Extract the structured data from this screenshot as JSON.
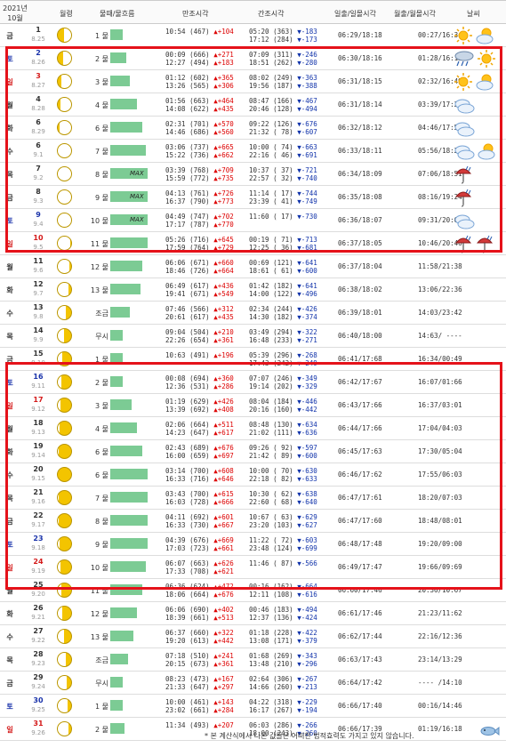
{
  "header": {
    "date_line1": "2021년",
    "date_line2": "10월",
    "phase": "월령",
    "tide": "물때/물흐름",
    "high": "만조시각",
    "low": "간조시각",
    "sun": "일출/일몰시각",
    "moon": "월출/월몰시각",
    "weather": "날씨"
  },
  "rows": [
    {
      "dow": "금",
      "day": "1",
      "lunar": "8.25",
      "mul": "1 물",
      "bar": 14,
      "hi1": "10:54 (467)",
      "hi1d": "▲+104",
      "hi2": "",
      "hi2d": "",
      "lo1": "05:20 (363)",
      "lo1d": "▼-183",
      "lo2": "17:12 (284)",
      "lo2d": "▼-173",
      "sun": "06:29/18:18",
      "moon": "00:27/16:34",
      "wx": [
        "sun",
        "suncloud"
      ],
      "illum": 0.5
    },
    {
      "dow": "토",
      "day": "2",
      "lunar": "8.26",
      "mul": "2 물",
      "bar": 18,
      "hi1": "00:09 (666)",
      "hi1d": "▲+271",
      "hi2": "12:27 (494)",
      "hi2d": "▲+183",
      "lo1": "07:09 (311)",
      "lo1d": "▼-246",
      "lo2": "18:51 (262)",
      "lo2d": "▼-280",
      "sun": "06:30/18:16",
      "moon": "01:28/16:13",
      "wx": [
        "rain",
        "sun"
      ],
      "illum": 0.45
    },
    {
      "dow": "일",
      "day": "3",
      "lunar": "8.27",
      "mul": "3 물",
      "bar": 22,
      "hi1": "01:12 (602)",
      "hi1d": "▲+365",
      "hi2": "13:26 (565)",
      "hi2d": "▲+306",
      "lo1": "08:02 (249)",
      "lo1d": "▼-363",
      "lo2": "19:56 (187)",
      "lo2d": "▼-388",
      "sun": "06:31/18:15",
      "moon": "02:32/16:49",
      "wx": [
        "sun",
        "suncloud"
      ],
      "illum": 0.38
    },
    {
      "dow": "월",
      "day": "4",
      "lunar": "8.28",
      "mul": "4 물",
      "bar": 30,
      "hi1": "01:56 (663)",
      "hi1d": "▲+464",
      "hi2": "14:08 (622)",
      "hi2d": "▲+435",
      "lo1": "08:47 (166)",
      "lo1d": "▼-467",
      "lo2": "20:46 (128)",
      "lo2d": "▼-494",
      "sun": "06:31/18:14",
      "moon": "03:39/17:21",
      "wx": [
        "cloud"
      ],
      "illum": 0.3
    },
    {
      "dow": "화",
      "day": "6",
      "lunar": "8.29",
      "mul": "6 물",
      "bar": 36,
      "hi1": "02:31 (701)",
      "hi1d": "▲+570",
      "hi2": "14:46 (686)",
      "hi2d": "▲+560",
      "lo1": "09:22 (126)",
      "lo1d": "▼-676",
      "lo2": "21:32 ( 78)",
      "lo2d": "▼-607",
      "sun": "06:32/18:12",
      "moon": "04:46/17:51",
      "wx": [
        "cloud"
      ],
      "illum": 0.22
    },
    {
      "dow": "수",
      "day": "6",
      "lunar": "9.1",
      "mul": "7 물",
      "bar": 40,
      "hi1": "03:06 (737)",
      "hi1d": "▲+665",
      "hi2": "15:22 (736)",
      "hi2d": "▲+662",
      "lo1": "10:00 ( 74)",
      "lo1d": "▼-663",
      "lo2": "22:16 ( 46)",
      "lo2d": "▼-691",
      "sun": "06:33/18:11",
      "moon": "05:56/18:20",
      "wx": [
        "cloud",
        "suncloud"
      ],
      "illum": 0.14
    },
    {
      "dow": "목",
      "day": "7",
      "lunar": "9.2",
      "mul": "8 물",
      "bar": 42,
      "max": "MAX",
      "hi1": "03:39 (768)",
      "hi1d": "▲+709",
      "hi2": "15:59 (772)",
      "hi2d": "▲+735",
      "lo1": "10:37 ( 37)",
      "lo1d": "▼-721",
      "lo2": "22:57 ( 32)",
      "lo2d": "▼-740",
      "sun": "06:34/18:09",
      "moon": "07:06/18:51",
      "wx": [
        "umbrella"
      ],
      "illum": 0.08
    },
    {
      "dow": "금",
      "day": "8",
      "lunar": "9.3",
      "mul": "9 물",
      "bar": 42,
      "max": "MAX",
      "hi1": "04:13 (761)",
      "hi1d": "▲+726",
      "hi2": "16:37 (790)",
      "hi2d": "▲+773",
      "lo1": "11:14 ( 17)",
      "lo1d": "▼-744",
      "lo2": "23:39 ( 41)",
      "lo2d": "▼-749",
      "sun": "06:35/18:08",
      "moon": "08:16/19:24",
      "wx": [
        "umbrella"
      ],
      "illum": 0.06
    },
    {
      "dow": "토",
      "day": "9",
      "lunar": "9.4",
      "mul": "10 물",
      "bar": 42,
      "max": "MAX",
      "hi1": "04:49 (747)",
      "hi1d": "▲+702",
      "hi2": "17:17 (787)",
      "hi2d": "▲+770",
      "lo1": "11:60 ( 17)",
      "lo1d": "▼-730",
      "lo2": "",
      "lo2d": "",
      "sun": "06:36/18:07",
      "moon": "09:31/20:02",
      "wx": [
        "cloud"
      ],
      "illum": 0.1
    },
    {
      "dow": "일",
      "day": "10",
      "lunar": "9.5",
      "mul": "11 물",
      "bar": 42,
      "hi1": "05:26 (716)",
      "hi1d": "▲+645",
      "hi2": "17:59 (764)",
      "hi2d": "▲+729",
      "lo1": "00:19 ( 71)",
      "lo1d": "▼-713",
      "lo2": "12:25 ( 36)",
      "lo2d": "▼-681",
      "sun": "06:37/18:05",
      "moon": "10:46/20:46",
      "wx": [
        "umbrella",
        "umbrella"
      ],
      "illum": 0.16
    },
    {
      "dow": "월",
      "day": "11",
      "lunar": "9.6",
      "mul": "12 물",
      "bar": 36,
      "hi1": "06:06 (671)",
      "hi1d": "▲+660",
      "hi2": "18:46 (726)",
      "hi2d": "▲+664",
      "lo1": "00:69 (121)",
      "lo1d": "▼-641",
      "lo2": "18:61 ( 61)",
      "lo2d": "▼-600",
      "sun": "06:37/18:04",
      "moon": "11:58/21:38",
      "wx": [],
      "illum": 0.22
    },
    {
      "dow": "화",
      "day": "12",
      "lunar": "9.7",
      "mul": "13 물",
      "bar": 34,
      "hi1": "06:49 (617)",
      "hi1d": "▲+436",
      "hi2": "19:41 (671)",
      "hi2d": "▲+549",
      "lo1": "01:42 (182)",
      "lo1d": "▼-641",
      "lo2": "14:00 (122)",
      "lo2d": "▼-496",
      "sun": "06:38/18:02",
      "moon": "13:06/22:36",
      "wx": [],
      "illum": 0.3
    },
    {
      "dow": "수",
      "day": "13",
      "lunar": "9.8",
      "mul": "조금",
      "bar": 22,
      "hi1": "07:46 (566)",
      "hi1d": "▲+312",
      "hi2": "20:61 (617)",
      "hi2d": "▲+435",
      "lo1": "02:34 (244)",
      "lo1d": "▼-426",
      "lo2": "14:30 (182)",
      "lo2d": "▼-374",
      "sun": "06:39/18:01",
      "moon": "14:03/23:42",
      "wx": [],
      "illum": 0.5
    },
    {
      "dow": "목",
      "day": "14",
      "lunar": "9.9",
      "mul": "무시",
      "bar": 14,
      "hi1": "09:04 (504)",
      "hi1d": "▲+210",
      "hi2": "22:26 (654)",
      "hi2d": "▲+361",
      "lo1": "03:49 (294)",
      "lo1d": "▼-322",
      "lo2": "16:48 (233)",
      "lo2d": "▼-271",
      "sun": "06:40/18:00",
      "moon": "14:63/ ----",
      "wx": [],
      "illum": 0.6
    },
    {
      "dow": "금",
      "day": "15",
      "lunar": "9.10",
      "mul": "1 물",
      "bar": 14,
      "hi1": "10:63 (491)",
      "hi1d": "▲+196",
      "hi2": "",
      "hi2d": "",
      "lo1": "05:39 (296)",
      "lo1d": "▼-268",
      "lo2": "17:43 (242)",
      "lo2d": "▼-249",
      "sun": "06:41/17:68",
      "moon": "16:34/00:49",
      "wx": [],
      "illum": 0.68
    },
    {
      "dow": "토",
      "day": "16",
      "lunar": "9.11",
      "mul": "2 물",
      "bar": 14,
      "hi1": "00:08 (694)",
      "hi1d": "▲+360",
      "hi2": "12:36 (531)",
      "hi2d": "▲+286",
      "lo1": "07:07 (246)",
      "lo1d": "▼-349",
      "lo2": "19:14 (202)",
      "lo2d": "▼-329",
      "sun": "06:42/17:67",
      "moon": "16:07/01:66",
      "wx": [],
      "illum": 0.76
    },
    {
      "dow": "일",
      "day": "17",
      "lunar": "9.12",
      "mul": "3 물",
      "bar": 24,
      "hi1": "01:19 (629)",
      "hi1d": "▲+426",
      "hi2": "13:39 (692)",
      "hi2d": "▲+408",
      "lo1": "08:04 (184)",
      "lo1d": "▼-446",
      "lo2": "20:16 (160)",
      "lo2d": "▼-442",
      "sun": "06:43/17:66",
      "moon": "16:37/03:01",
      "wx": [],
      "illum": 0.84
    },
    {
      "dow": "월",
      "day": "18",
      "lunar": "9.13",
      "mul": "4 물",
      "bar": 30,
      "hi1": "02:06 (664)",
      "hi1d": "▲+511",
      "hi2": "14:23 (647)",
      "hi2d": "▲+617",
      "lo1": "08:48 (130)",
      "lo1d": "▼-634",
      "lo2": "21:02 (111)",
      "lo2d": "▼-636",
      "sun": "06:44/17:66",
      "moon": "17:04/04:03",
      "wx": [],
      "illum": 0.9
    },
    {
      "dow": "화",
      "day": "19",
      "lunar": "9.14",
      "mul": "6 물",
      "bar": 36,
      "hi1": "02:43 (689)",
      "hi1d": "▲+676",
      "hi2": "16:00 (659)",
      "hi2d": "▲+697",
      "lo1": "09:26 ( 92)",
      "lo1d": "▼-597",
      "lo2": "21:42 ( 89)",
      "lo2d": "▼-600",
      "sun": "06:45/17:63",
      "moon": "17:30/05:04",
      "wx": [],
      "illum": 0.95
    },
    {
      "dow": "수",
      "day": "20",
      "lunar": "9.15",
      "mul": "6 물",
      "bar": 42,
      "hi1": "03:14 (700)",
      "hi1d": "▲+608",
      "hi2": "16:33 (716)",
      "hi2d": "▲+646",
      "lo1": "10:00 ( 70)",
      "lo1d": "▼-630",
      "lo2": "22:18 ( 82)",
      "lo2d": "▼-633",
      "sun": "06:46/17:62",
      "moon": "17:55/06:03",
      "wx": [],
      "illum": 1
    },
    {
      "dow": "목",
      "day": "21",
      "lunar": "9.16",
      "mul": "7 물",
      "bar": 42,
      "hi1": "03:43 (700)",
      "hi1d": "▲+615",
      "hi2": "16:03 (728)",
      "hi2d": "▲+666",
      "lo1": "10:30 ( 62)",
      "lo1d": "▼-638",
      "lo2": "22:60 ( 68)",
      "lo2d": "▼-640",
      "sun": "06:47/17:61",
      "moon": "18:20/07:03",
      "wx": [],
      "illum": 0.98
    },
    {
      "dow": "금",
      "day": "22",
      "lunar": "9.17",
      "mul": "8 물",
      "bar": 42,
      "hi1": "04:11 (692)",
      "hi1d": "▲+601",
      "hi2": "16:33 (730)",
      "hi2d": "▲+667",
      "lo1": "10:67 ( 63)",
      "lo1d": "▼-629",
      "lo2": "23:20 (103)",
      "lo2d": "▼-627",
      "sun": "06:47/17:60",
      "moon": "18:48/08:01",
      "wx": [],
      "illum": 0.94
    },
    {
      "dow": "토",
      "day": "23",
      "lunar": "9.18",
      "mul": "9 물",
      "bar": 42,
      "hi1": "04:39 (676)",
      "hi1d": "▲+669",
      "hi2": "17:03 (723)",
      "hi2d": "▲+661",
      "lo1": "11:22 ( 72)",
      "lo1d": "▼-603",
      "lo2": "23:48 (124)",
      "lo2d": "▼-699",
      "sun": "06:48/17:48",
      "moon": "19:20/09:00",
      "wx": [],
      "illum": 0.88
    },
    {
      "dow": "일",
      "day": "24",
      "lunar": "9.19",
      "mul": "10 물",
      "bar": 40,
      "hi1": "06:07 (663)",
      "hi1d": "▲+626",
      "hi2": "17:33 (708)",
      "hi2d": "▲+621",
      "lo1": "11:46 ( 87)",
      "lo1d": "▼-566",
      "lo2": "",
      "lo2d": "",
      "sun": "06:49/17:47",
      "moon": "19:66/09:69",
      "wx": [],
      "illum": 0.82
    },
    {
      "dow": "월",
      "day": "25",
      "lunar": "9.20",
      "mul": "11 물",
      "bar": 36,
      "hi1": "06:36 (624)",
      "hi1d": "▲+472",
      "hi2": "18:06 (664)",
      "hi2d": "▲+676",
      "lo1": "00:16 (162)",
      "lo1d": "▼-664",
      "lo2": "12:11 (108)",
      "lo2d": "▼-616",
      "sun": "06:60/17:46",
      "moon": "20:36/10:67",
      "wx": [],
      "illum": 0.76
    },
    {
      "dow": "화",
      "day": "26",
      "lunar": "9.21",
      "mul": "12 물",
      "bar": 30,
      "hi1": "06:06 (690)",
      "hi1d": "▲+402",
      "hi2": "18:39 (661)",
      "hi2d": "▲+513",
      "lo1": "00:46 (183)",
      "lo1d": "▼-494",
      "lo2": "12:37 (136)",
      "lo2d": "▼-424",
      "sun": "06:61/17:46",
      "moon": "21:23/11:62",
      "wx": [],
      "illum": 0.68
    },
    {
      "dow": "수",
      "day": "27",
      "lunar": "9.22",
      "mul": "13 물",
      "bar": 26,
      "hi1": "06:37 (660)",
      "hi1d": "▲+322",
      "hi2": "19:20 (613)",
      "hi2d": "▲+442",
      "lo1": "01:18 (228)",
      "lo1d": "▼-422",
      "lo2": "13:08 (171)",
      "lo2d": "▼-379",
      "sun": "06:62/17:44",
      "moon": "22:16/12:36",
      "wx": [],
      "illum": 0.6
    },
    {
      "dow": "목",
      "day": "28",
      "lunar": "9.23",
      "mul": "조금",
      "bar": 20,
      "hi1": "07:18 (510)",
      "hi1d": "▲+241",
      "hi2": "20:15 (673)",
      "hi2d": "▲+361",
      "lo1": "01:68 (269)",
      "lo1d": "▼-343",
      "lo2": "13:48 (210)",
      "lo2d": "▼-296",
      "sun": "06:63/17:43",
      "moon": "23:14/13:29",
      "wx": [],
      "illum": 0.5
    },
    {
      "dow": "금",
      "day": "29",
      "lunar": "9.24",
      "mul": "무시",
      "bar": 14,
      "hi1": "08:23 (473)",
      "hi1d": "▲+167",
      "hi2": "21:33 (647)",
      "hi2d": "▲+297",
      "lo1": "02:64 (306)",
      "lo1d": "▼-267",
      "lo2": "14:66 (260)",
      "lo2d": "▼-213",
      "sun": "06:64/17:42",
      "moon": "---- /14:10",
      "wx": [],
      "illum": 0.42
    },
    {
      "dow": "토",
      "day": "30",
      "lunar": "9.25",
      "mul": "1 물",
      "bar": 14,
      "hi1": "10:00 (461)",
      "hi1d": "▲+143",
      "hi2": "23:02 (661)",
      "hi2d": "▲+284",
      "lo1": "04:22 (318)",
      "lo1d": "▼-229",
      "lo2": "16:17 (267)",
      "lo2d": "▼-194",
      "sun": "06:66/17:40",
      "moon": "00:16/14:46",
      "wx": [],
      "illum": 0.36
    },
    {
      "dow": "일",
      "day": "31",
      "lunar": "9.26",
      "mul": "2 물",
      "bar": 16,
      "hi1": "11:34 (493)",
      "hi1d": "▲+207",
      "hi2": "",
      "hi2d": "",
      "lo1": "06:03 (286)",
      "lo1d": "▼-266",
      "lo2": "18:00 (243)",
      "lo2d": "▼-260",
      "sun": "06:66/17:39",
      "moon": "01:19/16:18",
      "wx": [],
      "illum": 0.3
    }
  ],
  "footer": "* 본 계산식에서 나온 값들은 어떠한 법적효력도 가지고 있지 않습니다.",
  "colors": {
    "sun": "#333333",
    "sat": "#1a33aa",
    "hol": "#d41a1a",
    "bar": "#7ccb94",
    "box": "#e5121a"
  }
}
